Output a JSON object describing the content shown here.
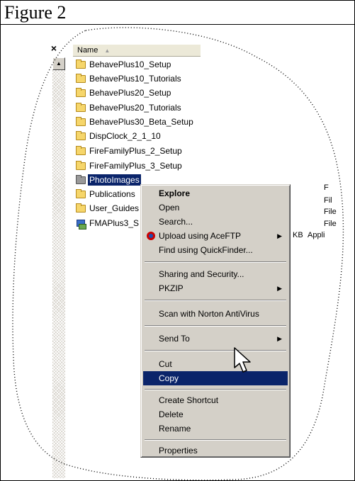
{
  "figure": {
    "title": "Figure 2"
  },
  "left_pane": {
    "close_glyph": "×",
    "scroll_up_glyph": "▲"
  },
  "list": {
    "column_header": "Name",
    "sort_glyph": "▲",
    "items": [
      {
        "label": "BehavePlus10_Setup",
        "icon": "folder-icon"
      },
      {
        "label": "BehavePlus10_Tutorials",
        "icon": "folder-icon"
      },
      {
        "label": "BehavePlus20_Setup",
        "icon": "folder-icon"
      },
      {
        "label": "BehavePlus20_Tutorials",
        "icon": "folder-icon"
      },
      {
        "label": "BehavePlus30_Beta_Setup",
        "icon": "folder-icon"
      },
      {
        "label": "DispClock_2_1_10",
        "icon": "folder-icon"
      },
      {
        "label": "FireFamilyPlus_2_Setup",
        "icon": "folder-icon"
      },
      {
        "label": "FireFamilyPlus_3_Setup",
        "icon": "folder-icon"
      },
      {
        "label": "PhotoImages",
        "icon": "folder-icon",
        "selected": true
      },
      {
        "label": "Publications",
        "icon": "folder-icon"
      },
      {
        "label": "User_Guides",
        "icon": "folder-icon"
      },
      {
        "label": "FMAPlus3_S",
        "icon": "application-icon"
      }
    ],
    "right_column": [
      "F",
      "Fil",
      "File",
      "File",
      "Appli"
    ],
    "size_suffix": "KB"
  },
  "context_menu": {
    "items": [
      {
        "label": "Explore",
        "bold": true
      },
      {
        "label": "Open"
      },
      {
        "label": "Search..."
      },
      {
        "label": "Upload using AceFTP",
        "submenu": true,
        "icon": "aceftp-icon"
      },
      {
        "label": "Find using QuickFinder..."
      },
      {
        "label": "Sharing and Security..."
      },
      {
        "label": "PKZIP",
        "submenu": true
      },
      {
        "label": "Scan with Norton AntiVirus"
      },
      {
        "label": "Send To",
        "submenu": true
      },
      {
        "label": "Cut"
      },
      {
        "label": "Copy",
        "highlighted": true
      },
      {
        "label": "Create Shortcut"
      },
      {
        "label": "Delete"
      },
      {
        "label": "Rename"
      },
      {
        "label": "Properties"
      }
    ],
    "submenu_glyph": "▶"
  },
  "colors": {
    "selection": "#0a246a",
    "menu_face": "#d4d0c8"
  }
}
